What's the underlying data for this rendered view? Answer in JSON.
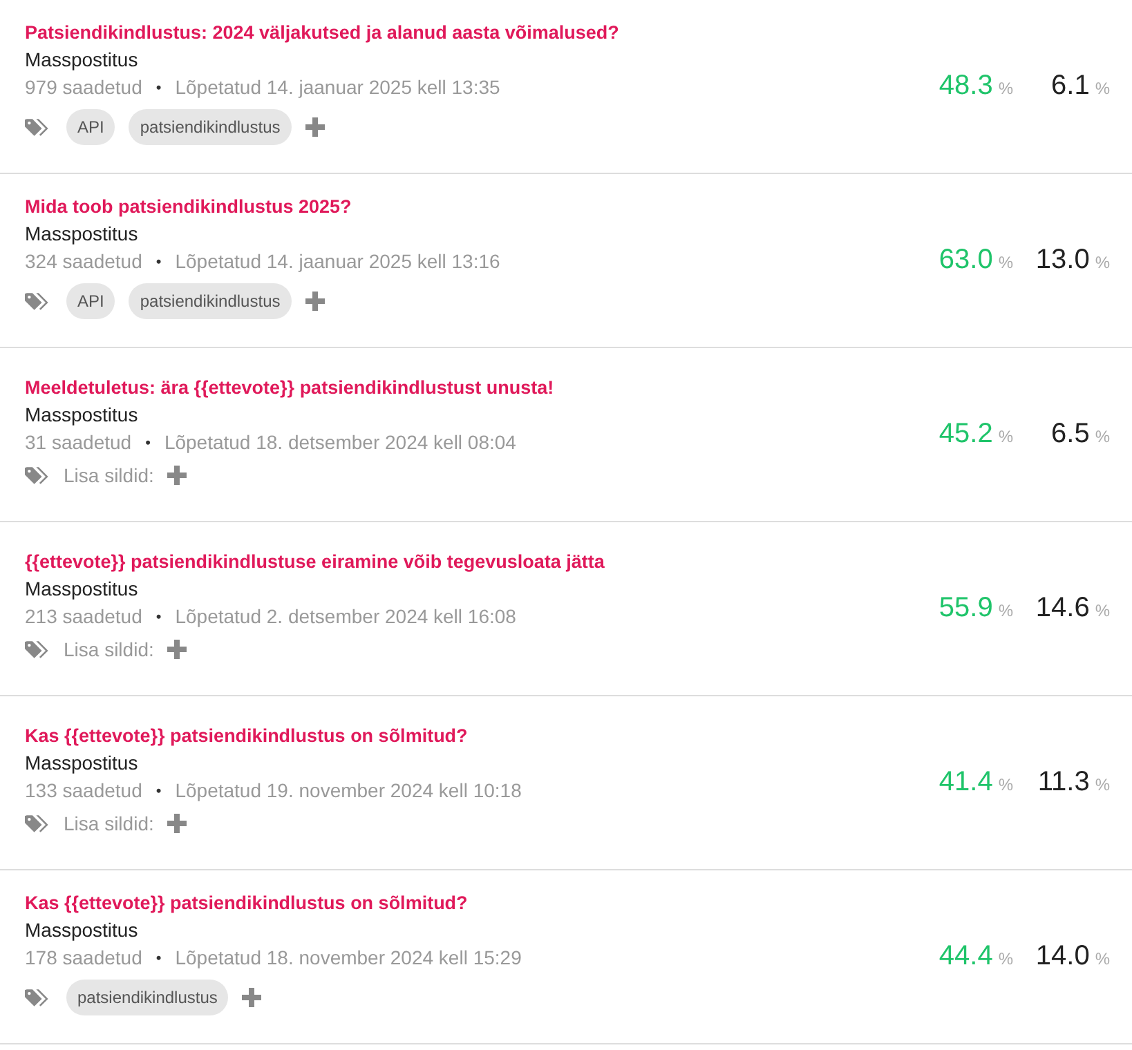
{
  "campaigns": [
    {
      "title": "Patsiendikindlustus: 2024 väljakutsed ja alanud aasta võimalused?",
      "type": "Masspostitus",
      "sent": "979 saadetud",
      "separator": "•",
      "finished": "Lõpetatud 14. jaanuar 2025 kell 13:35",
      "tags": [
        "API",
        "patsiendikindlustus"
      ],
      "open_rate": {
        "value": "48.3",
        "unit": "%"
      },
      "click_rate": {
        "value": "6.1",
        "unit": "%"
      }
    },
    {
      "title": "Mida toob patsiendikindlustus 2025?",
      "type": "Masspostitus",
      "sent": "324 saadetud",
      "separator": "•",
      "finished": "Lõpetatud 14. jaanuar 2025 kell 13:16",
      "tags": [
        "API",
        "patsiendikindlustus"
      ],
      "open_rate": {
        "value": "63.0",
        "unit": "%"
      },
      "click_rate": {
        "value": "13.0",
        "unit": "%"
      }
    },
    {
      "title": "Meeldetuletus: ära {{ettevote}} patsiendikindlustust unusta!",
      "type": "Masspostitus",
      "sent": "31 saadetud",
      "separator": "•",
      "finished": "Lõpetatud 18. detsember 2024 kell 08:04",
      "add_tags_label": "Lisa sildid:",
      "open_rate": {
        "value": "45.2",
        "unit": "%"
      },
      "click_rate": {
        "value": "6.5",
        "unit": "%"
      }
    },
    {
      "title": "{{ettevote}} patsiendikindlustuse eiramine võib tegevusloata jätta",
      "type": "Masspostitus",
      "sent": "213 saadetud",
      "separator": "•",
      "finished": "Lõpetatud 2. detsember 2024 kell 16:08",
      "add_tags_label": "Lisa sildid:",
      "open_rate": {
        "value": "55.9",
        "unit": "%"
      },
      "click_rate": {
        "value": "14.6",
        "unit": "%"
      }
    },
    {
      "title": "Kas {{ettevote}} patsiendikindlustus on sõlmitud?",
      "type": "Masspostitus",
      "sent": "133 saadetud",
      "separator": "•",
      "finished": "Lõpetatud 19. november 2024 kell 10:18",
      "add_tags_label": "Lisa sildid:",
      "open_rate": {
        "value": "41.4",
        "unit": "%"
      },
      "click_rate": {
        "value": "11.3",
        "unit": "%"
      }
    },
    {
      "title": "Kas {{ettevote}} patsiendikindlustus on sõlmitud?",
      "type": "Masspostitus",
      "sent": "178 saadetud",
      "separator": "•",
      "finished": "Lõpetatud 18. november 2024 kell 15:29",
      "tags": [
        "patsiendikindlustus"
      ],
      "open_rate": {
        "value": "44.4",
        "unit": "%"
      },
      "click_rate": {
        "value": "14.0",
        "unit": "%"
      }
    }
  ]
}
